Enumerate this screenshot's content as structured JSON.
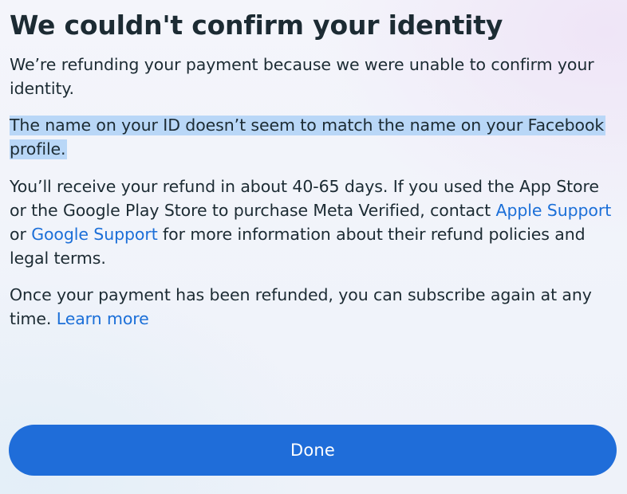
{
  "dialog": {
    "title": "We couldn't confirm your identity",
    "paragraph1": "We’re refunding your payment because we were unable to confirm your identity.",
    "paragraph2_highlighted": "The name on your ID doesn’t seem to match the name on your Facebook profile.",
    "paragraph3": {
      "text_before": "You’ll receive your refund in about 40-65 days. If you used the App Store or the Google Play Store to purchase Meta Verified, contact ",
      "apple_link": "Apple Support",
      "text_between": " or ",
      "google_link": "Google Support",
      "text_after": " for more information about their refund policies and legal terms."
    },
    "paragraph4": {
      "text": "Once your payment has been refunded, you can subscribe again at any time. ",
      "learn_more_link": "Learn more"
    },
    "done_button_label": "Done"
  },
  "colors": {
    "accent": "#1f6dd9",
    "link": "#1b6fd8",
    "highlight": "#b9d7f7",
    "text": "#1c2b33"
  }
}
